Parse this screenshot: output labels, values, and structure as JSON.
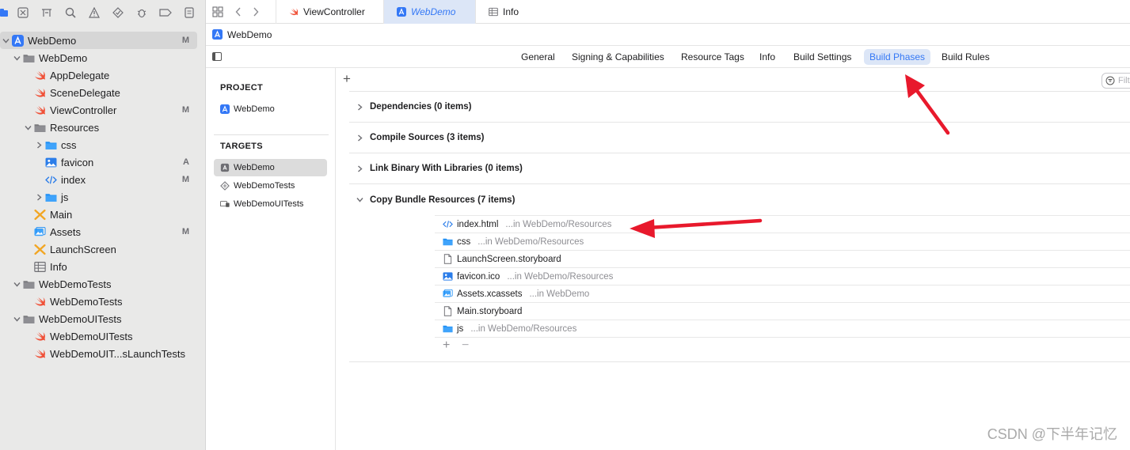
{
  "navigator": {
    "rows": [
      {
        "label": "WebDemo",
        "badge": "M",
        "icon": "xcode-project-icon",
        "disclosure": "expanded",
        "selected": true
      },
      {
        "label": "WebDemo",
        "badge": "",
        "icon": "folder-icon",
        "disclosure": "expanded"
      },
      {
        "label": "AppDelegate",
        "badge": "",
        "icon": "swift-file-icon"
      },
      {
        "label": "SceneDelegate",
        "badge": "",
        "icon": "swift-file-icon"
      },
      {
        "label": "ViewController",
        "badge": "M",
        "icon": "swift-file-icon"
      },
      {
        "label": "Resources",
        "badge": "",
        "icon": "folder-icon",
        "disclosure": "expanded"
      },
      {
        "label": "css",
        "badge": "",
        "icon": "blue-folder-icon",
        "disclosure": "collapsed"
      },
      {
        "label": "favicon",
        "badge": "A",
        "icon": "image-file-icon"
      },
      {
        "label": "index",
        "badge": "M",
        "icon": "html-file-icon"
      },
      {
        "label": "js",
        "badge": "",
        "icon": "blue-folder-icon",
        "disclosure": "collapsed"
      },
      {
        "label": "Main",
        "badge": "",
        "icon": "storyboard-icon"
      },
      {
        "label": "Assets",
        "badge": "M",
        "icon": "asset-catalog-icon"
      },
      {
        "label": "LaunchScreen",
        "badge": "",
        "icon": "storyboard-icon"
      },
      {
        "label": "Info",
        "badge": "",
        "icon": "plist-icon"
      },
      {
        "label": "WebDemoTests",
        "badge": "",
        "icon": "folder-icon",
        "disclosure": "expanded"
      },
      {
        "label": "WebDemoTests",
        "badge": "",
        "icon": "swift-file-icon"
      },
      {
        "label": "WebDemoUITests",
        "badge": "",
        "icon": "folder-icon",
        "disclosure": "expanded"
      },
      {
        "label": "WebDemoUITests",
        "badge": "",
        "icon": "swift-file-icon"
      },
      {
        "label": "WebDemoUIT...sLaunchTests",
        "badge": "",
        "icon": "swift-file-icon"
      }
    ]
  },
  "tabs": [
    {
      "label": "ViewController",
      "icon": "swift-file-icon",
      "active": false
    },
    {
      "label": "WebDemo",
      "icon": "xcode-project-icon",
      "active": true
    },
    {
      "label": "Info",
      "icon": "plist-icon",
      "active": false
    }
  ],
  "jumpbar": {
    "label": "WebDemo"
  },
  "settings_tabs": [
    {
      "label": "General",
      "active": false
    },
    {
      "label": "Signing & Capabilities",
      "active": false
    },
    {
      "label": "Resource Tags",
      "active": false
    },
    {
      "label": "Info",
      "active": false
    },
    {
      "label": "Build Settings",
      "active": false
    },
    {
      "label": "Build Phases",
      "active": true
    },
    {
      "label": "Build Rules",
      "active": false
    }
  ],
  "project_section": {
    "header": "PROJECT",
    "items": [
      "WebDemo"
    ]
  },
  "targets_section": {
    "header": "TARGETS",
    "items": [
      {
        "label": "WebDemo",
        "icon": "app-target-icon",
        "selected": true
      },
      {
        "label": "WebDemoTests",
        "icon": "unit-test-target-icon",
        "selected": false
      },
      {
        "label": "WebDemoUITests",
        "icon": "ui-test-target-icon",
        "selected": false
      }
    ]
  },
  "filter": {
    "placeholder": "Filter"
  },
  "phases": [
    {
      "title": "Dependencies (0 items)",
      "expanded": false
    },
    {
      "title": "Compile Sources (3 items)",
      "expanded": false
    },
    {
      "title": "Link Binary With Libraries (0 items)",
      "expanded": false
    },
    {
      "title": "Copy Bundle Resources (7 items)",
      "expanded": true
    }
  ],
  "copy_bundle_resources": [
    {
      "name": "index.html",
      "location": "...in WebDemo/Resources",
      "icon": "html-file-icon"
    },
    {
      "name": "css",
      "location": "...in WebDemo/Resources",
      "icon": "blue-folder-icon"
    },
    {
      "name": "LaunchScreen.storyboard",
      "location": "",
      "icon": "document-icon"
    },
    {
      "name": "favicon.ico",
      "location": "...in WebDemo/Resources",
      "icon": "image-file-icon"
    },
    {
      "name": "Assets.xcassets",
      "location": "...in WebDemo",
      "icon": "asset-catalog-icon"
    },
    {
      "name": "Main.storyboard",
      "location": "",
      "icon": "document-icon"
    },
    {
      "name": "js",
      "location": "...in WebDemo/Resources",
      "icon": "blue-folder-icon"
    }
  ],
  "add_remove": {
    "add": "+",
    "remove": "−"
  },
  "watermark": "CSDN @下半年记忆",
  "colors": {
    "accent": "#3478f6",
    "swift": "#f05138",
    "annotation_arrow": "#e8192c",
    "selection": "#d6d6d6"
  }
}
